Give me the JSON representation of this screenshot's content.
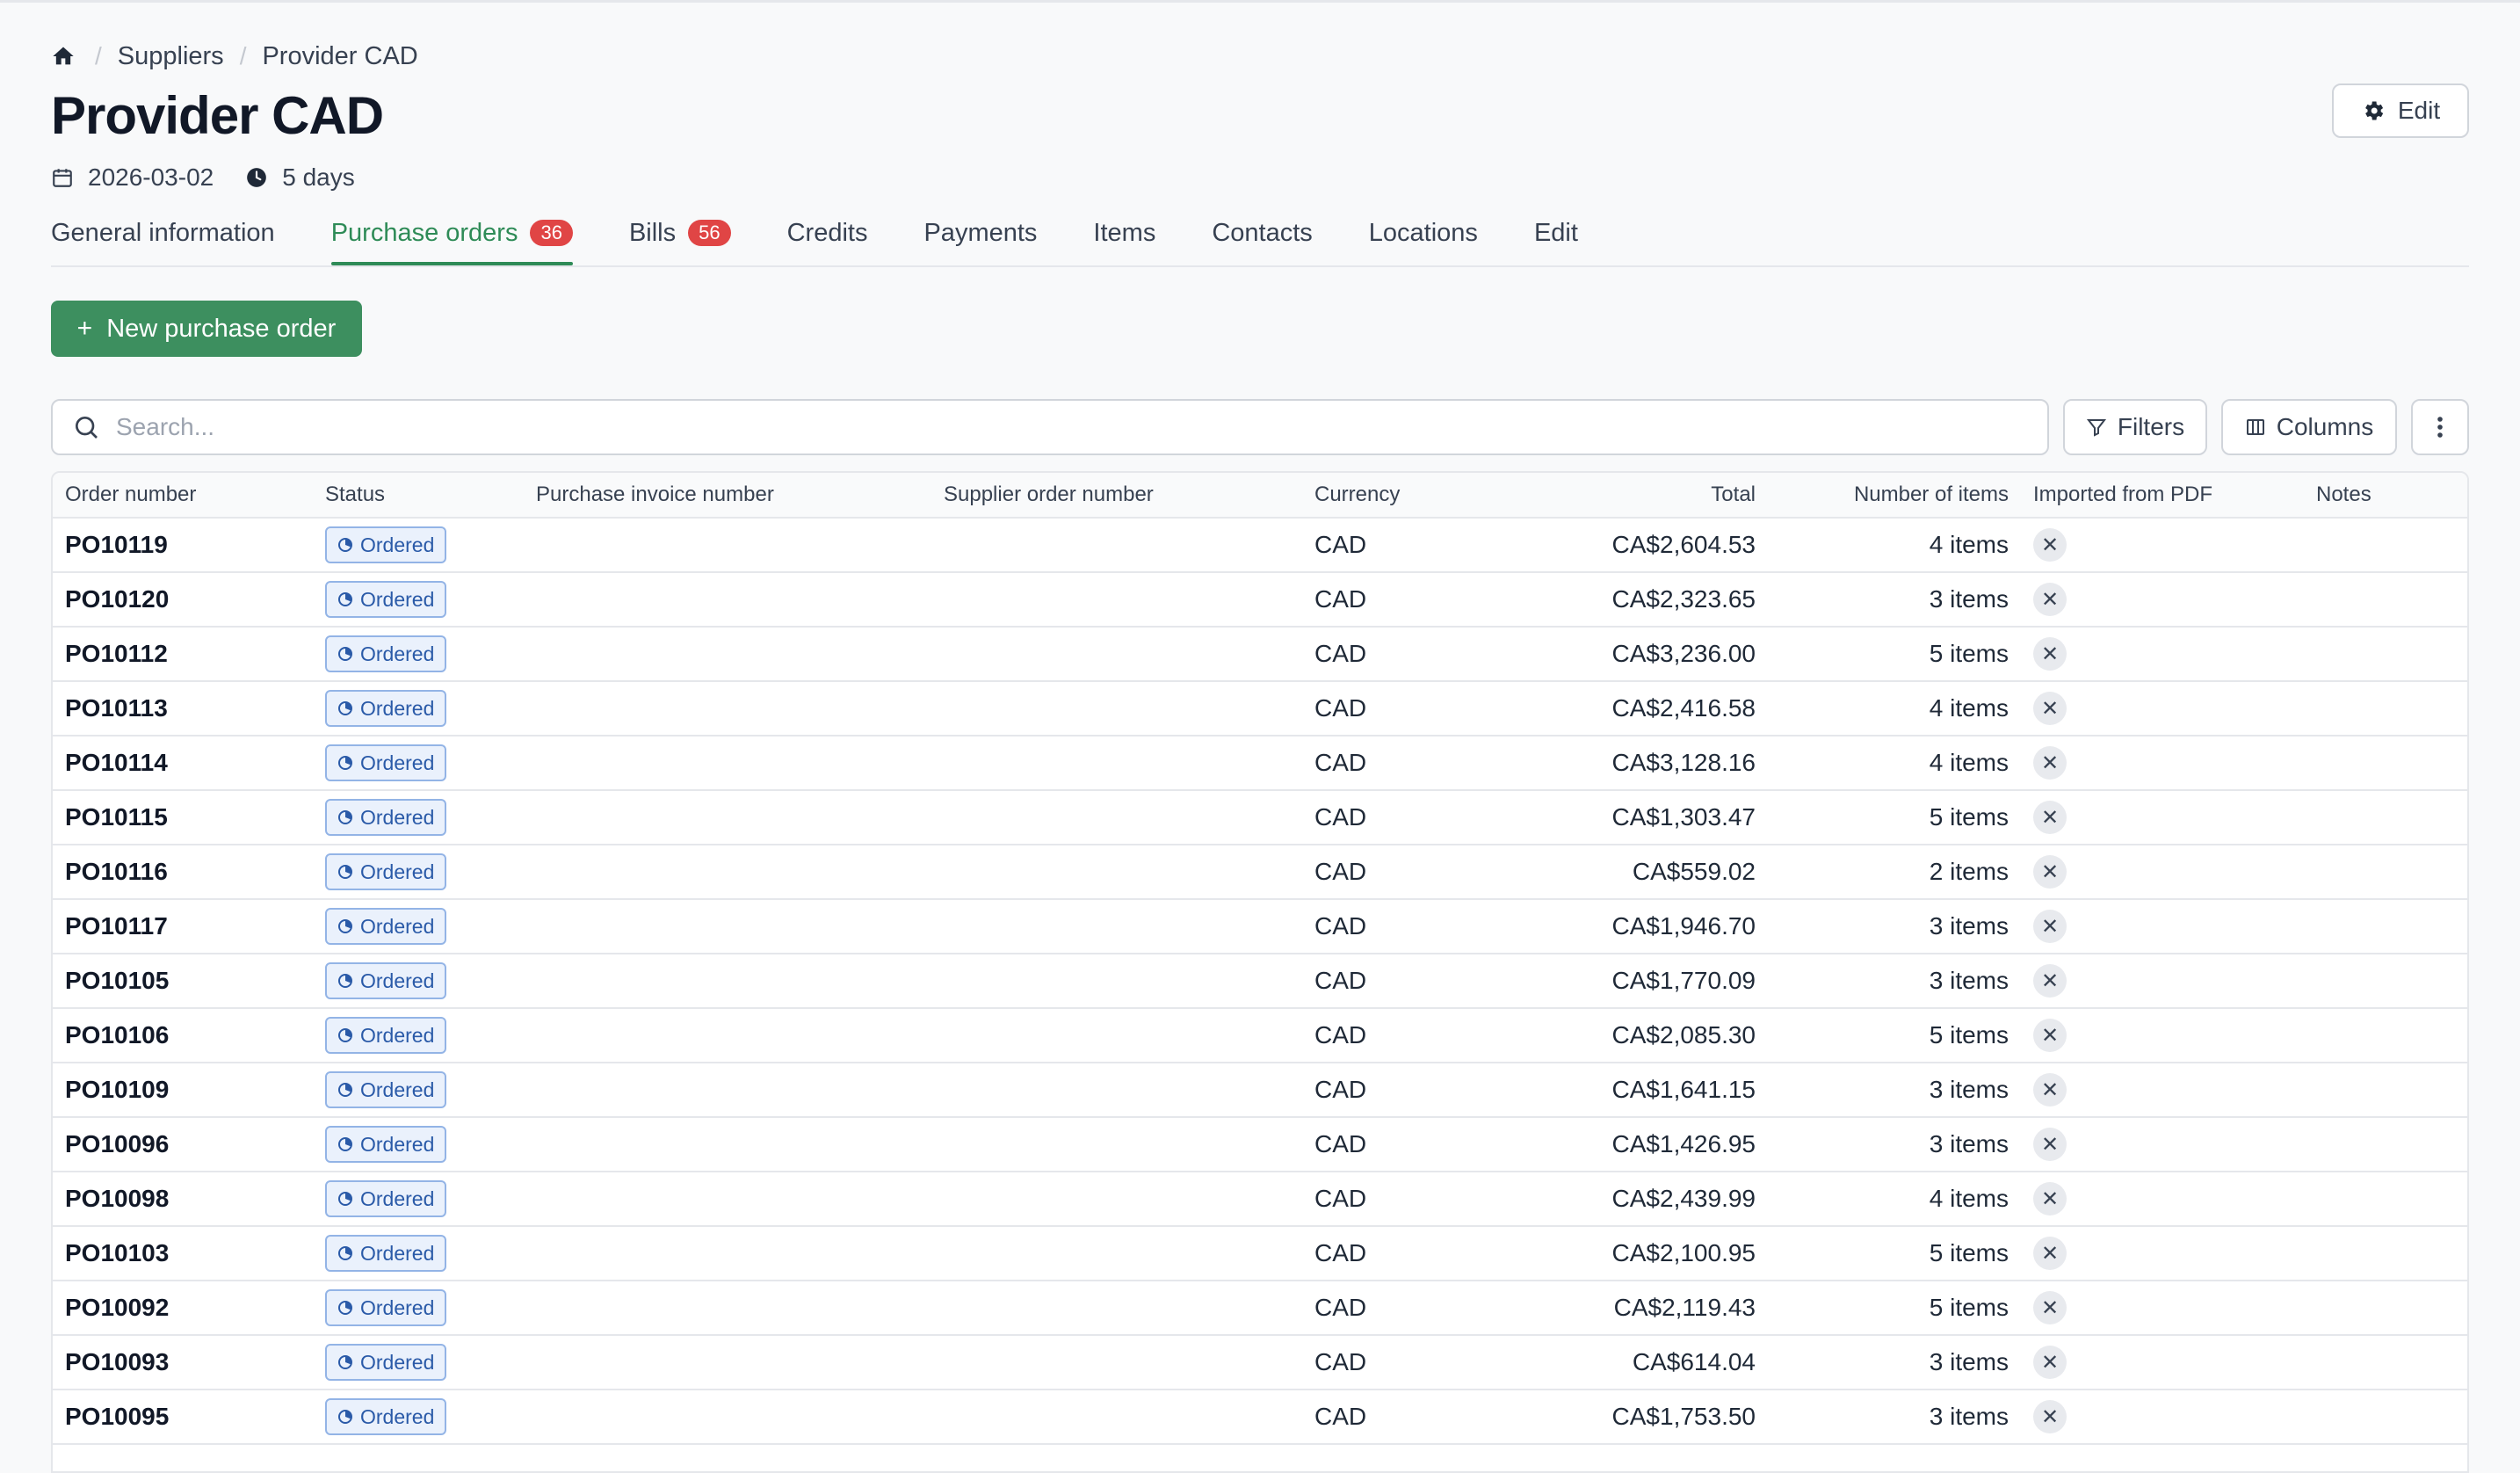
{
  "breadcrumb": {
    "home_icon": "home-icon",
    "items": [
      "Suppliers",
      "Provider CAD"
    ]
  },
  "header": {
    "title": "Provider CAD",
    "date": "2026-03-02",
    "duration": "5 days",
    "edit_label": "Edit"
  },
  "tabs": [
    {
      "label": "General information"
    },
    {
      "label": "Purchase orders",
      "badge": "36",
      "active": true
    },
    {
      "label": "Bills",
      "badge": "56"
    },
    {
      "label": "Credits"
    },
    {
      "label": "Payments"
    },
    {
      "label": "Items"
    },
    {
      "label": "Contacts"
    },
    {
      "label": "Locations"
    },
    {
      "label": "Edit"
    }
  ],
  "actions": {
    "new_po_label": "New purchase order",
    "search_placeholder": "Search...",
    "filters_label": "Filters",
    "columns_label": "Columns"
  },
  "colors": {
    "accent": "#2e8b57",
    "primary_button": "#3d8f5f",
    "badge": "#e04545",
    "status_border": "#93b4e6",
    "status_bg": "#eaf1fc",
    "status_text": "#2a5aa8"
  },
  "table": {
    "headers": [
      "Order number",
      "Status",
      "Purchase invoice number",
      "Supplier order number",
      "Currency",
      "Total",
      "Number of items",
      "Imported from PDF",
      "Notes"
    ],
    "rows": [
      {
        "order": "PO10119",
        "status": "Ordered",
        "currency": "CAD",
        "total": "CA$2,604.53",
        "items": "4 items"
      },
      {
        "order": "PO10120",
        "status": "Ordered",
        "currency": "CAD",
        "total": "CA$2,323.65",
        "items": "3 items"
      },
      {
        "order": "PO10112",
        "status": "Ordered",
        "currency": "CAD",
        "total": "CA$3,236.00",
        "items": "5 items"
      },
      {
        "order": "PO10113",
        "status": "Ordered",
        "currency": "CAD",
        "total": "CA$2,416.58",
        "items": "4 items"
      },
      {
        "order": "PO10114",
        "status": "Ordered",
        "currency": "CAD",
        "total": "CA$3,128.16",
        "items": "4 items"
      },
      {
        "order": "PO10115",
        "status": "Ordered",
        "currency": "CAD",
        "total": "CA$1,303.47",
        "items": "5 items"
      },
      {
        "order": "PO10116",
        "status": "Ordered",
        "currency": "CAD",
        "total": "CA$559.02",
        "items": "2 items"
      },
      {
        "order": "PO10117",
        "status": "Ordered",
        "currency": "CAD",
        "total": "CA$1,946.70",
        "items": "3 items"
      },
      {
        "order": "PO10105",
        "status": "Ordered",
        "currency": "CAD",
        "total": "CA$1,770.09",
        "items": "3 items"
      },
      {
        "order": "PO10106",
        "status": "Ordered",
        "currency": "CAD",
        "total": "CA$2,085.30",
        "items": "5 items"
      },
      {
        "order": "PO10109",
        "status": "Ordered",
        "currency": "CAD",
        "total": "CA$1,641.15",
        "items": "3 items"
      },
      {
        "order": "PO10096",
        "status": "Ordered",
        "currency": "CAD",
        "total": "CA$1,426.95",
        "items": "3 items"
      },
      {
        "order": "PO10098",
        "status": "Ordered",
        "currency": "CAD",
        "total": "CA$2,439.99",
        "items": "4 items"
      },
      {
        "order": "PO10103",
        "status": "Ordered",
        "currency": "CAD",
        "total": "CA$2,100.95",
        "items": "5 items"
      },
      {
        "order": "PO10092",
        "status": "Ordered",
        "currency": "CAD",
        "total": "CA$2,119.43",
        "items": "5 items"
      },
      {
        "order": "PO10093",
        "status": "Ordered",
        "currency": "CAD",
        "total": "CA$614.04",
        "items": "3 items"
      },
      {
        "order": "PO10095",
        "status": "Ordered",
        "currency": "CAD",
        "total": "CA$1,753.50",
        "items": "3 items"
      }
    ]
  }
}
